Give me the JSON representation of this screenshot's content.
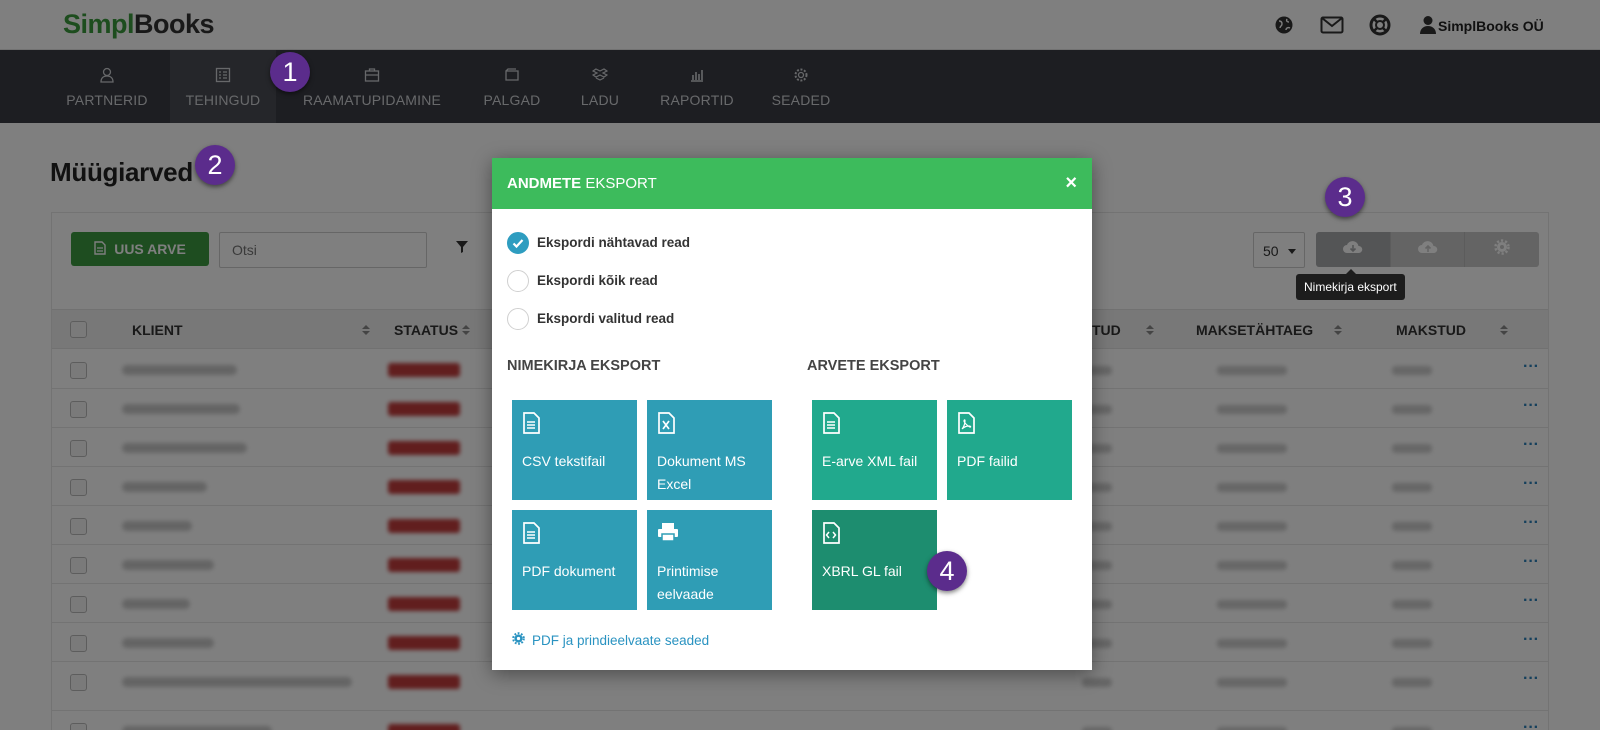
{
  "header": {
    "logo_part1": "Simpl",
    "logo_part2": "Books",
    "company": "SimplBooks OÜ",
    "icons": [
      "globe-icon",
      "mail-icon",
      "help-icon",
      "user-icon"
    ]
  },
  "nav": [
    {
      "label": "PARTNERID",
      "icon": "user-icon"
    },
    {
      "label": "TEHINGUD",
      "icon": "invoice-icon"
    },
    {
      "label": "RAAMATUPIDAMINE",
      "icon": "briefcase-icon"
    },
    {
      "label": "PALGAD",
      "icon": "wallet-icon"
    },
    {
      "label": "LADU",
      "icon": "boxes-icon"
    },
    {
      "label": "RAPORTID",
      "icon": "chart-icon"
    },
    {
      "label": "SEADED",
      "icon": "gear-icon"
    }
  ],
  "page": {
    "title": "Müügiarved",
    "new_button": "UUS ARVE",
    "search_placeholder": "Otsi",
    "per_page": "50",
    "tooltip": "Nimekirja eksport"
  },
  "table": {
    "headers": {
      "client": "KLIENT",
      "status": "STAATUS",
      "paid_short": "TUD",
      "due": "MAKSETÄHTAEG",
      "paid": "MAKSTUD"
    },
    "row_menu": "···"
  },
  "modal": {
    "title_bold": "ANDMETE",
    "title_rest": " EKSPORT",
    "close": "×",
    "options": [
      {
        "label": "Ekspordi nähtavad read",
        "selected": true
      },
      {
        "label": "Ekspordi kõik read",
        "selected": false
      },
      {
        "label": "Ekspordi valitud read",
        "selected": false
      }
    ],
    "list_export_title": "NIMEKIRJA EKSPORT",
    "invoice_export_title": "ARVETE EKSPORT",
    "list_tiles": [
      {
        "label": "CSV tekstifail",
        "icon": "file-text-icon"
      },
      {
        "label": "Dokument MS Excel",
        "icon": "file-excel-icon"
      },
      {
        "label": "PDF dokument",
        "icon": "file-text-icon"
      },
      {
        "label": "Printimise eelvaade",
        "icon": "printer-icon"
      }
    ],
    "invoice_tiles": [
      {
        "label": "E-arve XML fail",
        "icon": "file-text-icon"
      },
      {
        "label": "PDF failid",
        "icon": "file-pdf-icon"
      },
      {
        "label": "XBRL GL fail",
        "icon": "file-code-icon"
      }
    ],
    "settings_link": "PDF ja prindieelvaate seaded"
  },
  "annotations": [
    "1",
    "2",
    "3",
    "4"
  ],
  "colors": {
    "brand_green": "#3a9a3c",
    "nav_bg": "#3a3d45",
    "modal_header": "#3dbb5c",
    "tile_blue": "#2f9db5",
    "tile_green": "#21a98d",
    "badge": "#5b2c8c"
  }
}
